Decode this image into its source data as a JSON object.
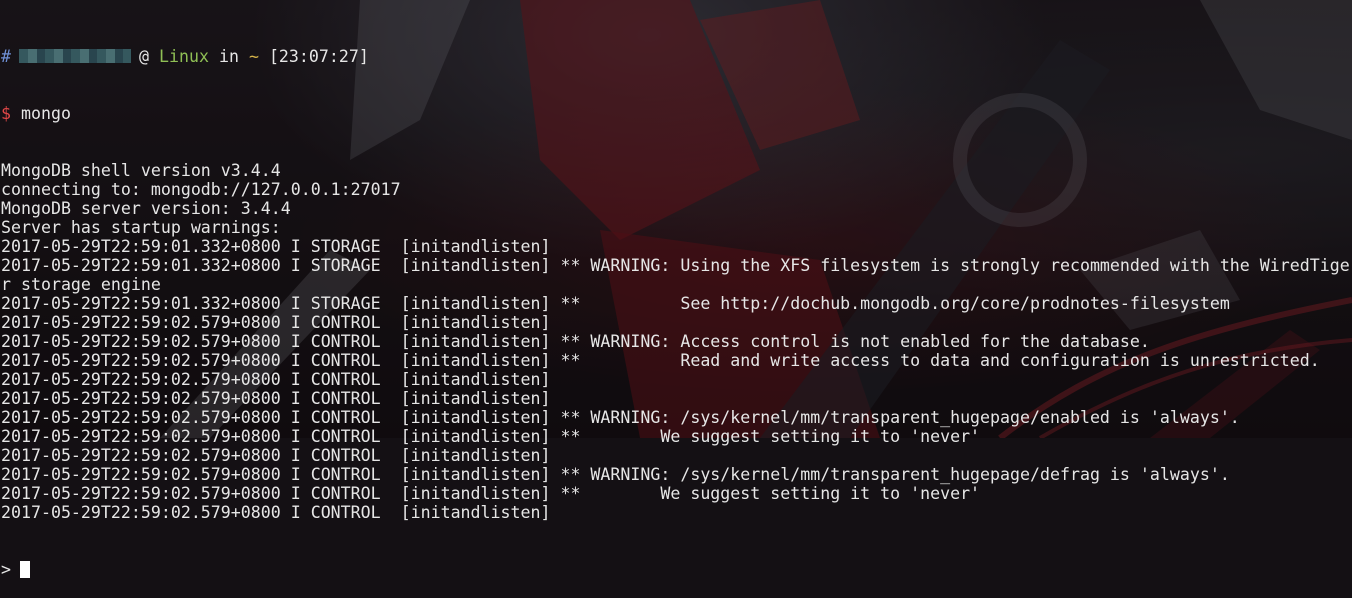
{
  "prompt": {
    "hash": "#",
    "at": "@",
    "host": "Linux",
    "in": "in",
    "dir": "~",
    "time": "[23:07:27]"
  },
  "command": {
    "symbol": "$",
    "text": "mongo"
  },
  "output": {
    "lines": [
      "MongoDB shell version v3.4.4",
      "connecting to: mongodb://127.0.0.1:27017",
      "MongoDB server version: 3.4.4",
      "Server has startup warnings:",
      "2017-05-29T22:59:01.332+0800 I STORAGE  [initandlisten]",
      "2017-05-29T22:59:01.332+0800 I STORAGE  [initandlisten] ** WARNING: Using the XFS filesystem is strongly recommended with the WiredTige",
      "r storage engine",
      "2017-05-29T22:59:01.332+0800 I STORAGE  [initandlisten] **          See http://dochub.mongodb.org/core/prodnotes-filesystem",
      "2017-05-29T22:59:02.579+0800 I CONTROL  [initandlisten]",
      "2017-05-29T22:59:02.579+0800 I CONTROL  [initandlisten] ** WARNING: Access control is not enabled for the database.",
      "2017-05-29T22:59:02.579+0800 I CONTROL  [initandlisten] **          Read and write access to data and configuration is unrestricted.",
      "2017-05-29T22:59:02.579+0800 I CONTROL  [initandlisten]",
      "2017-05-29T22:59:02.579+0800 I CONTROL  [initandlisten]",
      "2017-05-29T22:59:02.579+0800 I CONTROL  [initandlisten] ** WARNING: /sys/kernel/mm/transparent_hugepage/enabled is 'always'.",
      "2017-05-29T22:59:02.579+0800 I CONTROL  [initandlisten] **        We suggest setting it to 'never'",
      "2017-05-29T22:59:02.579+0800 I CONTROL  [initandlisten]",
      "2017-05-29T22:59:02.579+0800 I CONTROL  [initandlisten] ** WARNING: /sys/kernel/mm/transparent_hugepage/defrag is 'always'.",
      "2017-05-29T22:59:02.579+0800 I CONTROL  [initandlisten] **        We suggest setting it to 'never'",
      "2017-05-29T22:59:02.579+0800 I CONTROL  [initandlisten]"
    ]
  },
  "shell_prompt": ">",
  "colors": {
    "text": "#e6e6e6",
    "hash": "#6f90d6",
    "host": "#8fbf55",
    "dir": "#d7b54a",
    "dollar": "#e04747",
    "cursor": "#ffffff"
  }
}
